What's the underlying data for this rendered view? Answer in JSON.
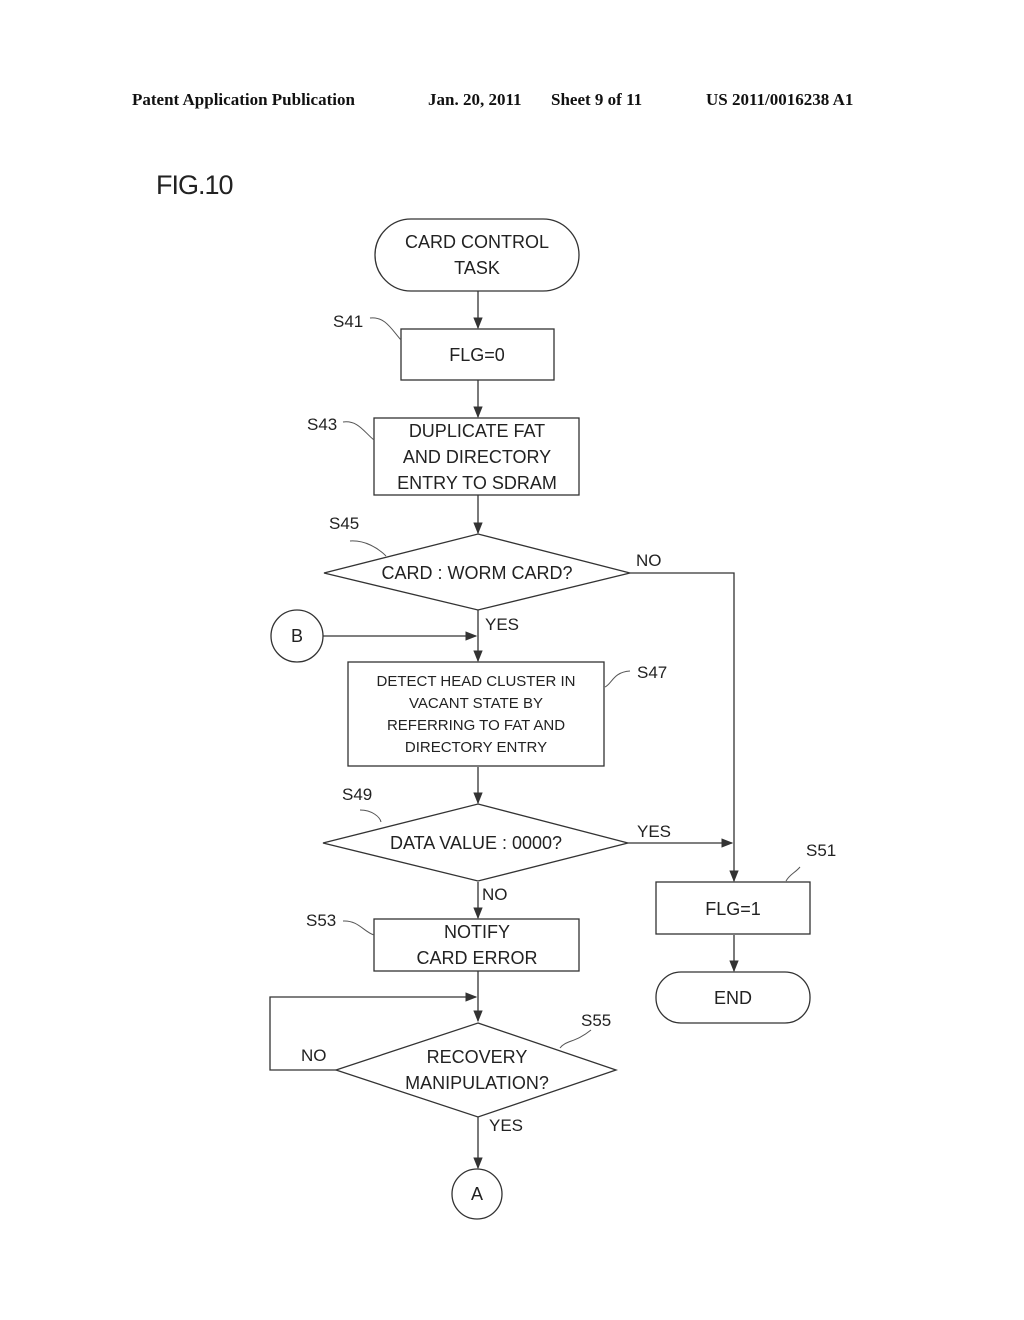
{
  "header": {
    "publication": "Patent Application Publication",
    "date": "Jan. 20, 2011",
    "sheet": "Sheet 9 of 11",
    "number": "US 2011/0016238 A1"
  },
  "figure": {
    "title": "FIG.10"
  },
  "nodes": {
    "start": {
      "type": "terminal",
      "lines": [
        "CARD CONTROL",
        "TASK"
      ]
    },
    "s41": {
      "step": "S41",
      "type": "process",
      "lines": [
        "FLG=0"
      ]
    },
    "s43": {
      "step": "S43",
      "type": "process",
      "lines": [
        "DUPLICATE FAT",
        "AND DIRECTORY",
        "ENTRY TO SDRAM"
      ]
    },
    "s45": {
      "step": "S45",
      "type": "decision",
      "lines": [
        "CARD : WORM CARD?"
      ]
    },
    "s47": {
      "step": "S47",
      "type": "process",
      "lines": [
        "DETECT HEAD CLUSTER IN",
        "VACANT STATE BY",
        "REFERRING TO FAT AND",
        "DIRECTORY ENTRY"
      ]
    },
    "s49": {
      "step": "S49",
      "type": "decision",
      "lines": [
        "DATA VALUE : 0000?"
      ]
    },
    "s51": {
      "step": "S51",
      "type": "process",
      "lines": [
        "FLG=1"
      ]
    },
    "end": {
      "type": "terminal",
      "lines": [
        "END"
      ]
    },
    "s53": {
      "step": "S53",
      "type": "process",
      "lines": [
        "NOTIFY",
        "CARD ERROR"
      ]
    },
    "s55": {
      "step": "S55",
      "type": "decision",
      "lines": [
        "RECOVERY",
        "MANIPULATION?"
      ]
    },
    "connector_b": {
      "type": "connector",
      "label": "B"
    },
    "connector_a": {
      "type": "connector",
      "label": "A"
    }
  },
  "branches": {
    "s45_no": "NO",
    "s45_yes": "YES",
    "s49_yes": "YES",
    "s49_no": "NO",
    "s55_no": "NO",
    "s55_yes": "YES"
  },
  "edges": [
    {
      "from": "start",
      "to": "s41"
    },
    {
      "from": "s41",
      "to": "s43"
    },
    {
      "from": "s43",
      "to": "s45"
    },
    {
      "from": "s45",
      "to": "s47",
      "label": "YES"
    },
    {
      "from": "s45",
      "to": "s51",
      "label": "NO"
    },
    {
      "from": "connector_b",
      "to": "s47"
    },
    {
      "from": "s47",
      "to": "s49"
    },
    {
      "from": "s49",
      "to": "s51",
      "label": "YES"
    },
    {
      "from": "s49",
      "to": "s53",
      "label": "NO"
    },
    {
      "from": "s51",
      "to": "end"
    },
    {
      "from": "s53",
      "to": "s55"
    },
    {
      "from": "s55",
      "to": "s55",
      "label": "NO"
    },
    {
      "from": "s55",
      "to": "connector_a",
      "label": "YES"
    }
  ]
}
